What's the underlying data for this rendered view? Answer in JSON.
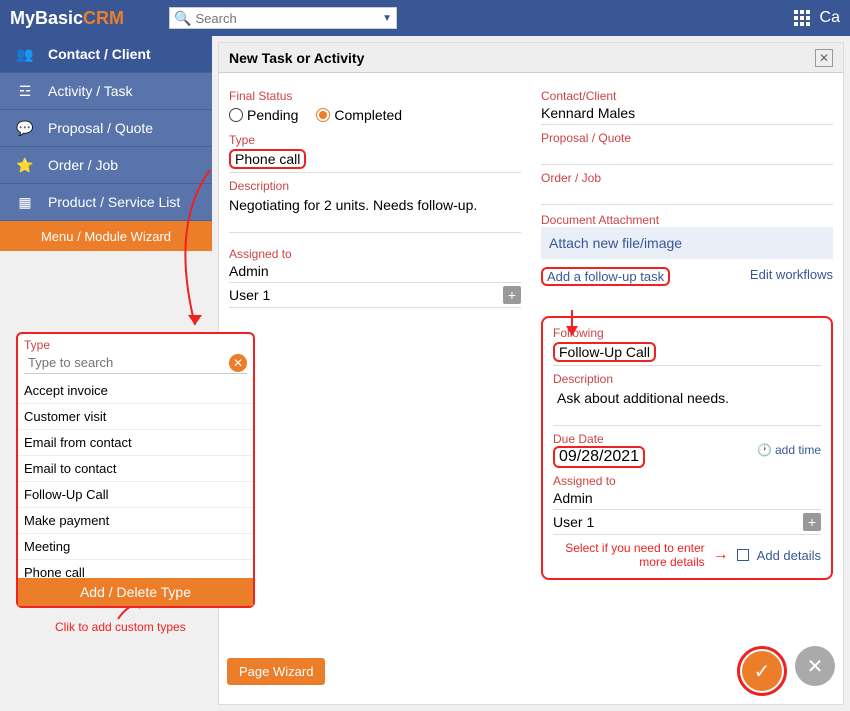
{
  "logo": {
    "part1": "MyBasic",
    "part2": "CRM"
  },
  "search": {
    "placeholder": "Search"
  },
  "top_right": {
    "label": "Ca"
  },
  "sidebar": {
    "items": [
      {
        "label": "Contact / Client"
      },
      {
        "label": "Activity / Task"
      },
      {
        "label": "Proposal / Quote"
      },
      {
        "label": "Order / Job"
      },
      {
        "label": "Product / Service List"
      }
    ],
    "menu_wizard": "Menu / Module Wizard"
  },
  "panel": {
    "title": "New Task or Activity"
  },
  "form": {
    "final_status_label": "Final Status",
    "pending": "Pending",
    "completed": "Completed",
    "type_label": "Type",
    "type_value": "Phone call",
    "description_label": "Description",
    "description_value": "Negotiating for 2 units. Needs follow-up.",
    "assigned_to_label": "Assigned to",
    "assigned_admin": "Admin",
    "assigned_user1": "User 1",
    "contact_label": "Contact/Client",
    "contact_value": "Kennard Males",
    "proposal_label": "Proposal / Quote",
    "order_label": "Order / Job",
    "attachment_label": "Document Attachment",
    "attach_text": "Attach new file/image",
    "add_followup_link": "Add a follow-up task",
    "edit_workflows_link": "Edit workflows"
  },
  "followup": {
    "following_label": "Following",
    "following_value": "Follow-Up Call",
    "description_label": "Description",
    "description_value": "Ask about additional needs.",
    "due_date_label": "Due Date",
    "due_date_value": "09/28/2021",
    "add_time": "add time",
    "assigned_to_label": "Assigned to",
    "assigned_admin": "Admin",
    "assigned_user1": "User 1",
    "select_hint": "Select if you need to enter more details",
    "add_details": "Add details"
  },
  "footer": {
    "page_wizard": "Page Wizard"
  },
  "type_popup": {
    "title": "Type",
    "search_placeholder": "Type to search",
    "items": [
      "Accept invoice",
      "Customer visit",
      "Email from contact",
      "Email to contact",
      "Follow-Up Call",
      "Make payment",
      "Meeting",
      "Phone call"
    ],
    "footer": "Add / Delete Type"
  },
  "notes": {
    "click_to_add": "Clik to add custom types"
  }
}
